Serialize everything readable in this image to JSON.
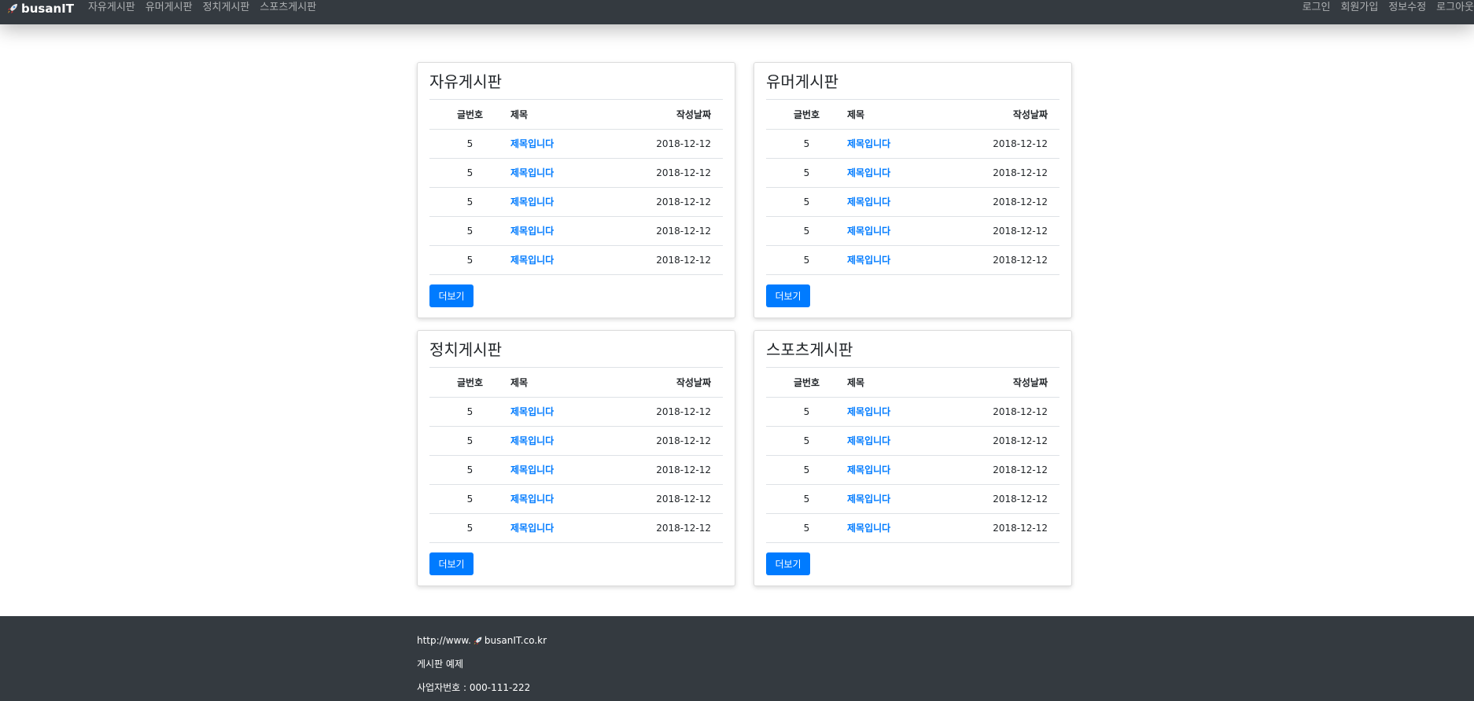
{
  "navbar": {
    "brand": "busanIT",
    "brand_icon": "rocket-icon",
    "links": [
      "자유게시판",
      "유머게시판",
      "정치게시판",
      "스포츠게시판"
    ],
    "right_links": [
      "로그인",
      "회원가입",
      "정보수정",
      "로그아웃"
    ]
  },
  "boards": [
    {
      "title": "자유게시판",
      "headers": [
        "글번호",
        "제목",
        "작성날짜"
      ],
      "rows": [
        {
          "num": "5",
          "title": "제목입니다",
          "date": "2018-12-12"
        },
        {
          "num": "5",
          "title": "제목입니다",
          "date": "2018-12-12"
        },
        {
          "num": "5",
          "title": "제목입니다",
          "date": "2018-12-12"
        },
        {
          "num": "5",
          "title": "제목입니다",
          "date": "2018-12-12"
        },
        {
          "num": "5",
          "title": "제목입니다",
          "date": "2018-12-12"
        }
      ],
      "more_label": "더보기"
    },
    {
      "title": "유머게시판",
      "headers": [
        "글번호",
        "제목",
        "작성날짜"
      ],
      "rows": [
        {
          "num": "5",
          "title": "제목입니다",
          "date": "2018-12-12"
        },
        {
          "num": "5",
          "title": "제목입니다",
          "date": "2018-12-12"
        },
        {
          "num": "5",
          "title": "제목입니다",
          "date": "2018-12-12"
        },
        {
          "num": "5",
          "title": "제목입니다",
          "date": "2018-12-12"
        },
        {
          "num": "5",
          "title": "제목입니다",
          "date": "2018-12-12"
        }
      ],
      "more_label": "더보기"
    },
    {
      "title": "정치게시판",
      "headers": [
        "글번호",
        "제목",
        "작성날짜"
      ],
      "rows": [
        {
          "num": "5",
          "title": "제목입니다",
          "date": "2018-12-12"
        },
        {
          "num": "5",
          "title": "제목입니다",
          "date": "2018-12-12"
        },
        {
          "num": "5",
          "title": "제목입니다",
          "date": "2018-12-12"
        },
        {
          "num": "5",
          "title": "제목입니다",
          "date": "2018-12-12"
        },
        {
          "num": "5",
          "title": "제목입니다",
          "date": "2018-12-12"
        }
      ],
      "more_label": "더보기"
    },
    {
      "title": "스포츠게시판",
      "headers": [
        "글번호",
        "제목",
        "작성날짜"
      ],
      "rows": [
        {
          "num": "5",
          "title": "제목입니다",
          "date": "2018-12-12"
        },
        {
          "num": "5",
          "title": "제목입니다",
          "date": "2018-12-12"
        },
        {
          "num": "5",
          "title": "제목입니다",
          "date": "2018-12-12"
        },
        {
          "num": "5",
          "title": "제목입니다",
          "date": "2018-12-12"
        },
        {
          "num": "5",
          "title": "제목입니다",
          "date": "2018-12-12"
        }
      ],
      "more_label": "더보기"
    }
  ],
  "footer": {
    "url_prefix": "http://www.",
    "url_suffix": "busanIT.co.kr",
    "subtitle": "게시판 예제",
    "business_number": "사업자번호 : 000-111-222"
  },
  "colors": {
    "navbar_bg": "#343a40",
    "link": "#007bff",
    "button_bg": "#007bff",
    "footer_bg": "#343a40"
  }
}
